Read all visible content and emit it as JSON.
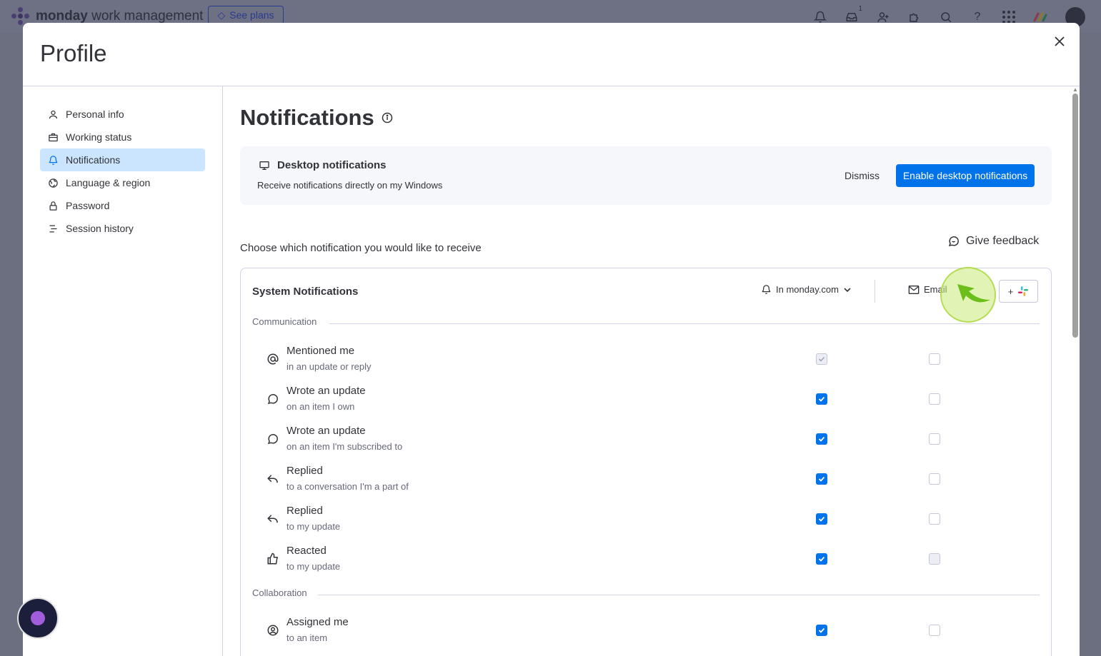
{
  "topbar": {
    "brand_bold": "monday",
    "brand_light": "work management",
    "see_plans": "See plans",
    "inbox_badge": "1"
  },
  "modal": {
    "title": "Profile"
  },
  "sidebar": {
    "items": [
      {
        "label": "Personal info",
        "icon": "person-icon"
      },
      {
        "label": "Working status",
        "icon": "briefcase-icon"
      },
      {
        "label": "Notifications",
        "icon": "bell-icon",
        "active": true
      },
      {
        "label": "Language & region",
        "icon": "globe-icon"
      },
      {
        "label": "Password",
        "icon": "lock-icon"
      },
      {
        "label": "Session history",
        "icon": "list-icon"
      }
    ]
  },
  "content": {
    "title": "Notifications",
    "desktop": {
      "title": "Desktop notifications",
      "subtitle": "Receive notifications directly on my Windows",
      "dismiss": "Dismiss",
      "enable": "Enable desktop notifications"
    },
    "choose_text": "Choose which notification you would like to receive",
    "feedback": "Give feedback",
    "system": {
      "title": "System Notifications",
      "col_monday": "In monday.com",
      "col_email": "Email",
      "slack_plus": "+"
    },
    "groups": [
      {
        "label": "Communication",
        "rows": [
          {
            "title": "Mentioned me",
            "sub": "in an update or reply",
            "icon": "at-icon",
            "monday": "disabled-checked",
            "email": "unchecked"
          },
          {
            "title": "Wrote an update",
            "sub": "on an item I own",
            "icon": "comment-icon",
            "monday": "checked",
            "email": "unchecked"
          },
          {
            "title": "Wrote an update",
            "sub": "on an item I'm subscribed to",
            "icon": "comment-icon",
            "monday": "checked",
            "email": "unchecked"
          },
          {
            "title": "Replied",
            "sub": "to a conversation I'm a part of",
            "icon": "reply-icon",
            "monday": "checked",
            "email": "unchecked"
          },
          {
            "title": "Replied",
            "sub": "to my update",
            "icon": "reply-icon",
            "monday": "checked",
            "email": "unchecked"
          },
          {
            "title": "Reacted",
            "sub": "to my update",
            "icon": "thumbs-up-icon",
            "monday": "checked",
            "email": "disabled"
          }
        ]
      },
      {
        "label": "Collaboration",
        "rows": [
          {
            "title": "Assigned me",
            "sub": "to an item",
            "icon": "person-circle-icon",
            "monday": "checked",
            "email": "unchecked"
          }
        ]
      }
    ]
  },
  "colors": {
    "primary": "#0073ea",
    "active_bg": "#cce5ff",
    "border": "#d0d4e4"
  }
}
